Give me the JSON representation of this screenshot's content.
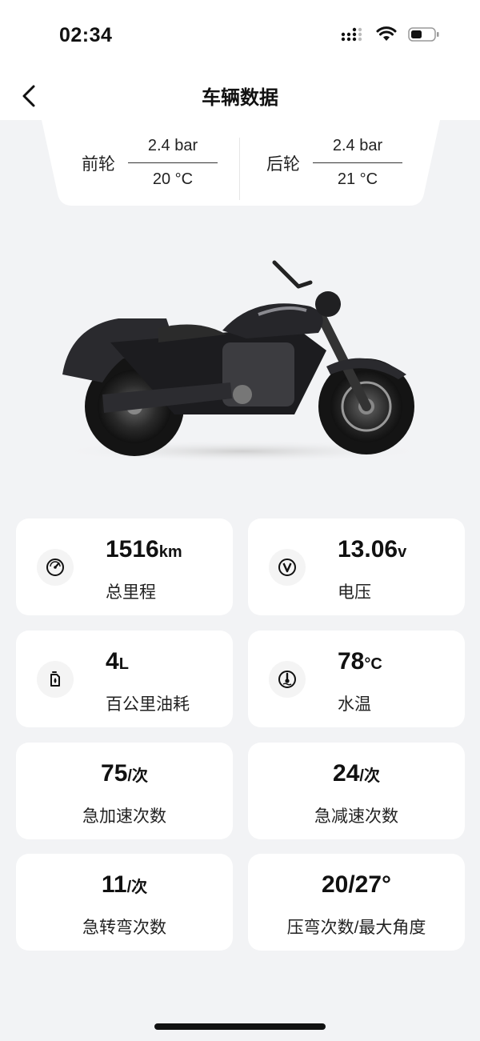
{
  "status_bar": {
    "time": "02:34"
  },
  "header": {
    "title": "车辆数据"
  },
  "tires": {
    "front": {
      "label": "前轮",
      "pressure": "2.4 bar",
      "temp": "20 °C"
    },
    "rear": {
      "label": "后轮",
      "pressure": "2.4 bar",
      "temp": "21 °C"
    }
  },
  "stats": [
    {
      "value": "1516",
      "unit": "km",
      "label": "总里程",
      "icon": "odometer-icon"
    },
    {
      "value": "13.06",
      "unit": "v",
      "label": "电压",
      "icon": "voltage-icon"
    },
    {
      "value": "4",
      "unit": "L",
      "label": "百公里油耗",
      "icon": "fuel-icon"
    },
    {
      "value": "78",
      "unit": "°C",
      "label": "水温",
      "icon": "coolant-temp-icon"
    },
    {
      "value": "75",
      "unit": "/次",
      "label": "急加速次数"
    },
    {
      "value": "24",
      "unit": "/次",
      "label": "急减速次数"
    },
    {
      "value": "11",
      "unit": "/次",
      "label": "急转弯次数"
    },
    {
      "value": "20/27°",
      "unit": "",
      "label": "压弯次数/最大角度"
    }
  ]
}
